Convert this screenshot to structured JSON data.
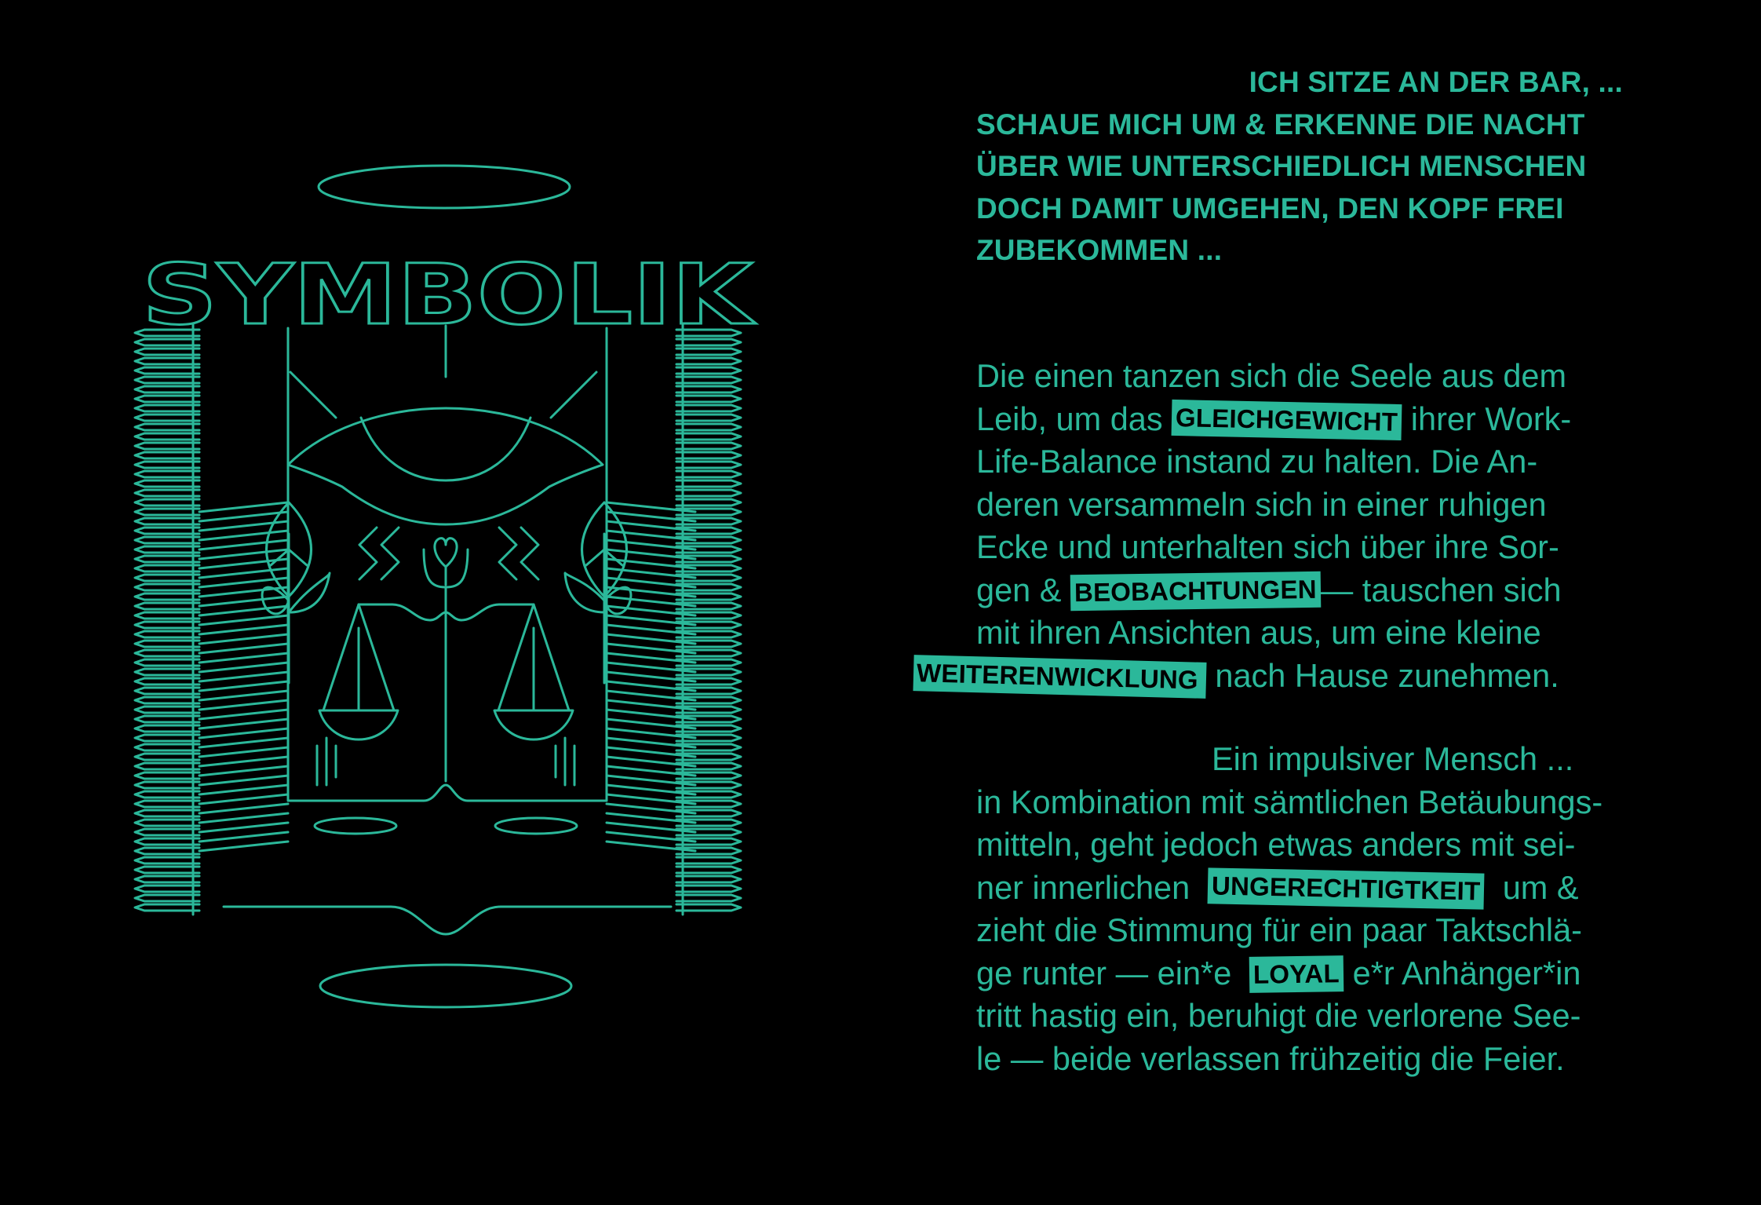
{
  "art": {
    "title": "SYMBOLIK"
  },
  "intro": {
    "lines": [
      "ICH SITZE AN DER BAR, ...",
      "SCHAUE MICH UM & ERKENNE DIE NACHT",
      "ÜBER WIE UNTERSCHIEDLICH MENSCHEN",
      "DOCH DAMIT UMGEHEN, DEN KOPF FREI",
      "ZUBEKOMMEN ..."
    ]
  },
  "paragraph1": {
    "l1": "Die einen tanzen sich die Seele aus dem",
    "l2_a": "Leib, um das ",
    "l2_hl": "GLEICHGEWICHT",
    "l2_b": " ihrer Work-",
    "l3": "Life-Balance instand zu halten. Die An-",
    "l4": "deren versammeln sich in einer ruhigen",
    "l5": "Ecke und unterhalten sich über ihre Sor-",
    "l6_a": "gen & ",
    "l6_hl": "BEOBACHTUNGEN",
    "l6_b": "— tauschen sich",
    "l7": "mit ihren Ansichten aus, um eine kleine",
    "l8_hl": "WEITERENWICKLUNG",
    "l8_b": " nach Hause zunehmen."
  },
  "paragraph2": {
    "l1": "Ein impulsiver Mensch ...",
    "l2": "in Kombination mit sämtlichen Betäubungs-",
    "l3": "mitteln, geht jedoch etwas anders mit sei-",
    "l4_a": "ner innerlichen  ",
    "l4_hl": "UNGERECHTIGTKEIT",
    "l4_b": "  um &",
    "l5": "zieht die Stimmung für ein paar Taktschlä-",
    "l6_a": "ge runter — ein*e  ",
    "l6_hl": "LOYAL",
    "l6_b": " e*r Anhänger*in",
    "l7": "tritt hastig ein, beruhigt die verlorene See-",
    "l8": "le — beide verlassen frühzeitig die Feier."
  },
  "colors": {
    "background": "#000000",
    "accent": "#2bb89a",
    "highlight_text": "#000000"
  }
}
